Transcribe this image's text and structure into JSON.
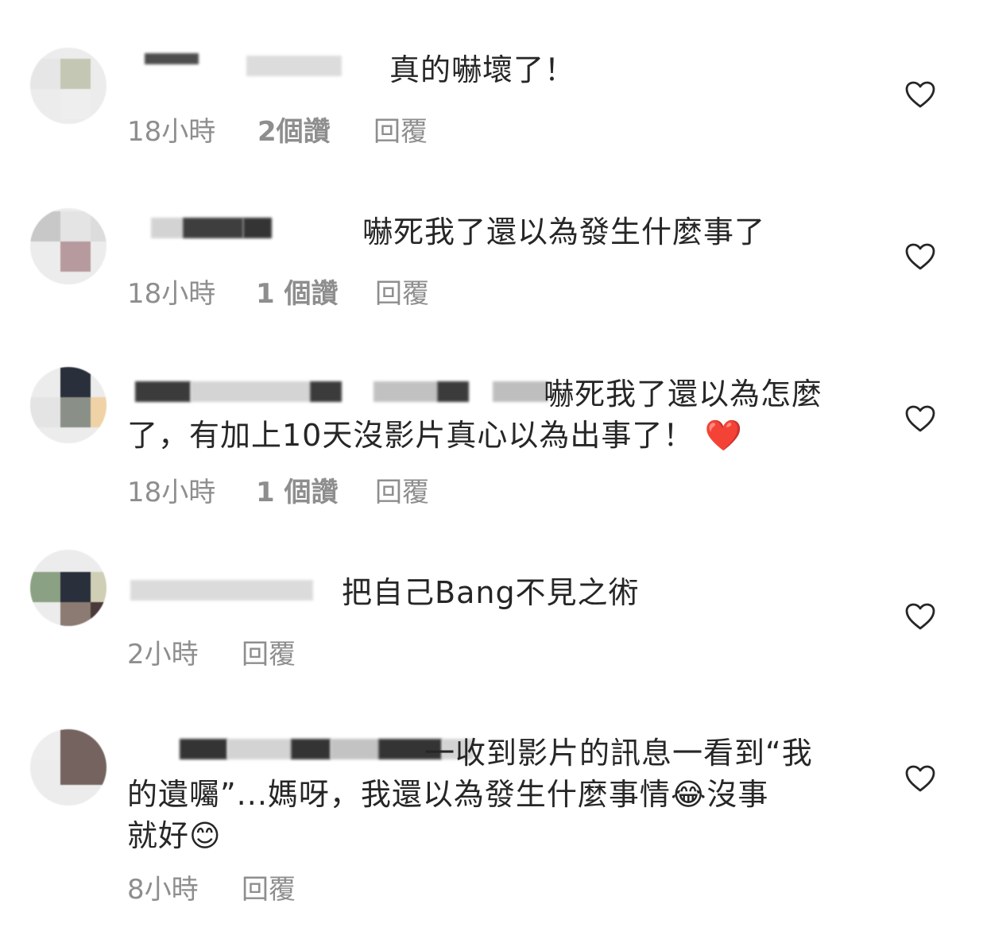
{
  "comments": [
    {
      "text": "真的嚇壞了！",
      "time": "18小時",
      "likes": "2個讚",
      "reply": "回覆"
    },
    {
      "text": "嚇死我了還以為發生什麼事了",
      "time": "18小時",
      "likes": "1 個讚",
      "reply": "回覆"
    },
    {
      "text_line1": "嚇死我了還以為怎麼",
      "text_line2": "了，有加上10天沒影片真心以為出事了！",
      "emoji": "❤️",
      "time": "18小時",
      "likes": "1 個讚",
      "reply": "回覆"
    },
    {
      "text": "把自己Bang不見之術",
      "time": "2小時",
      "reply": "回覆"
    },
    {
      "text_line1": "一收到影片的訊息一看到“我",
      "text_line2a": "的遺囑”...媽呀，我還以為發生什麼事情",
      "emoji_a": "😂",
      "text_line2b": "沒事",
      "text_line3": "就好",
      "emoji_b": "😊",
      "time": "8小時",
      "reply": "回覆"
    }
  ],
  "icons": {
    "like": "heart-outline-icon"
  },
  "colors": {
    "text": "#262626",
    "meta": "#8e8e8e",
    "icon": "#262626"
  }
}
